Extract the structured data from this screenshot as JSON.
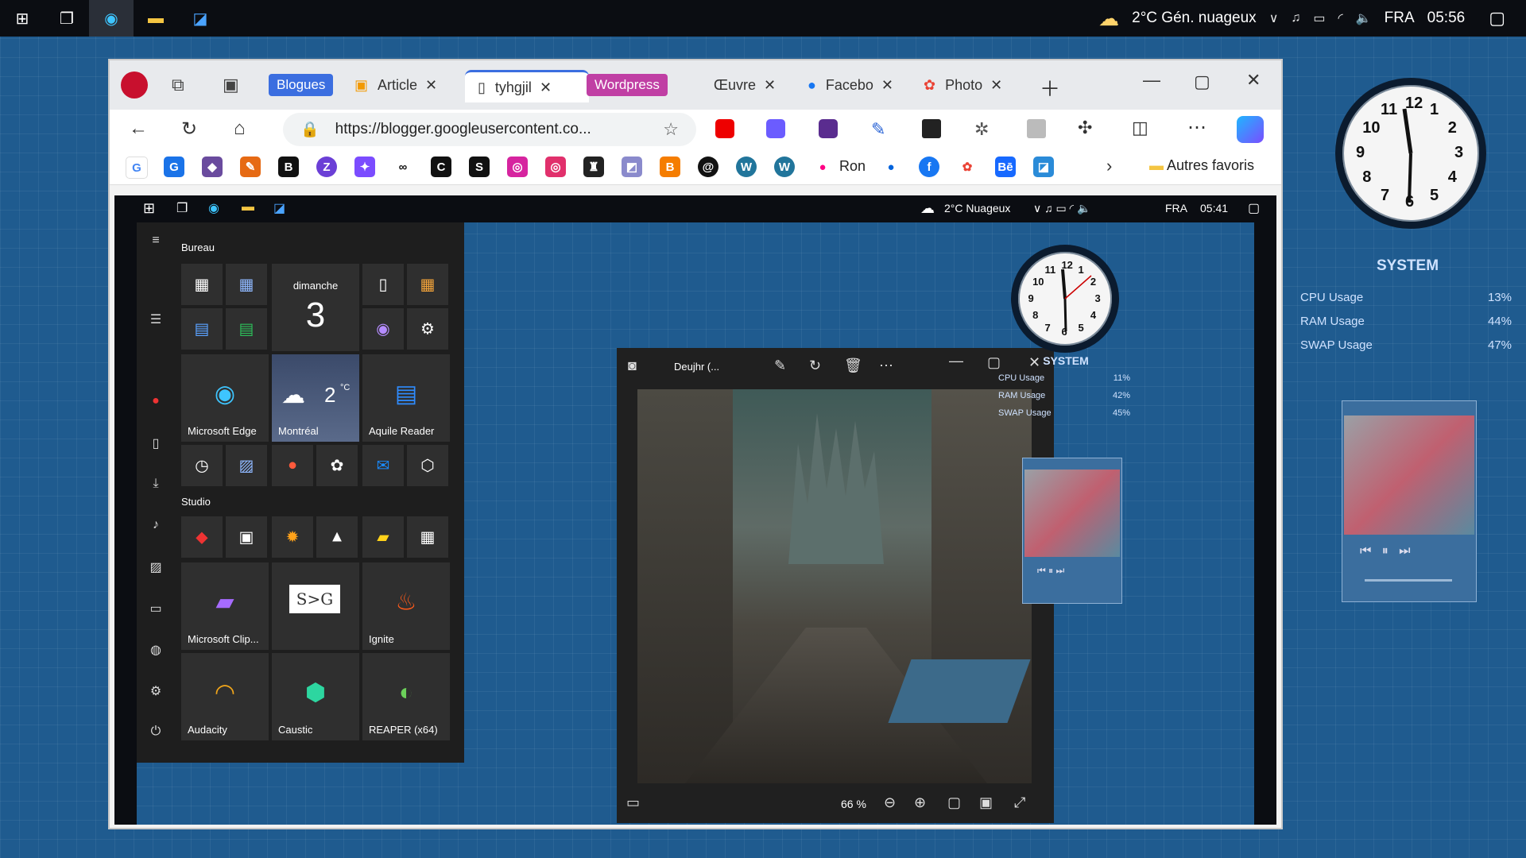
{
  "taskbar": {
    "weather": "2°C Gén. nuageux",
    "lang": "FRA",
    "time": "05:56"
  },
  "browser": {
    "tabs": [
      {
        "label": "Blogues",
        "group_color": "#3b6ee0"
      },
      {
        "label": "Article"
      },
      {
        "label": "tyhgjil"
      },
      {
        "label": "Wordpress",
        "group_color": "#c03fa4"
      },
      {
        "label": "Œuvre"
      },
      {
        "label": "Facebo"
      },
      {
        "label": "Photo"
      }
    ],
    "url": "https://blogger.googleusercontent.co...",
    "favorites": {
      "ron_label": "Ron",
      "other_label": "Autres favoris"
    }
  },
  "inner": {
    "weather": "2°C  Nuageux",
    "lang": "FRA",
    "time": "05:41"
  },
  "start_menu": {
    "group1": "Bureau",
    "group2": "Studio",
    "calendar_day": "dimanche",
    "calendar_date": "3",
    "weather_temp": "2",
    "weather_unit": "°C",
    "tiles": {
      "edge": "Microsoft Edge",
      "montreal": "Montréal",
      "aquile": "Aquile Reader",
      "clipchamp": "Microsoft Clip...",
      "ignite": "Ignite",
      "audacity": "Audacity",
      "caustic": "Caustic",
      "reaper": "REAPER (x64)",
      "sg": "S>G"
    }
  },
  "photos": {
    "title": "Deujhr (...",
    "zoom": "66 %"
  },
  "widgets": {
    "system_title": "SYSTEM",
    "big": {
      "cpu_label": "CPU Usage",
      "cpu": "13%",
      "ram_label": "RAM Usage",
      "ram": "44%",
      "swap_label": "SWAP Usage",
      "swap": "47%"
    },
    "small": {
      "cpu_label": "CPU Usage",
      "cpu": "11%",
      "ram_label": "RAM Usage",
      "ram": "42%",
      "swap_label": "SWAP Usage",
      "swap": "45%"
    },
    "clock_numbers": [
      "12",
      "1",
      "2",
      "3",
      "4",
      "5",
      "6",
      "7",
      "8",
      "9",
      "10",
      "11"
    ]
  }
}
